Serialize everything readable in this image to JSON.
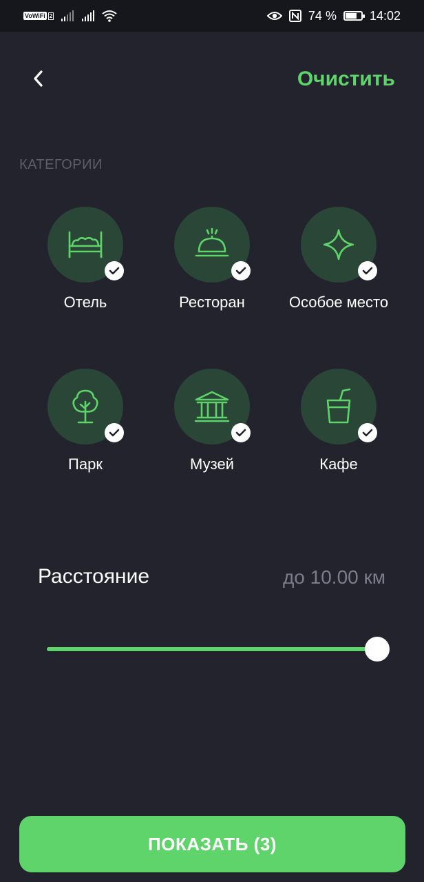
{
  "status_bar": {
    "vowifi": "VoWiFi",
    "vowifi_num": "2",
    "battery_percent": "74 %",
    "battery_level": 0.74,
    "time": "14:02"
  },
  "header": {
    "back_icon": "chevron-left-icon",
    "clear_label": "Очистить"
  },
  "categories_section": {
    "title": "КАТЕГОРИИ",
    "items": [
      {
        "label": "Отель",
        "icon": "bed-icon",
        "selected": true
      },
      {
        "label": "Ресторан",
        "icon": "cloche-icon",
        "selected": true
      },
      {
        "label": "Особое место",
        "icon": "sparkle-icon",
        "selected": true
      },
      {
        "label": "Парк",
        "icon": "tree-icon",
        "selected": true
      },
      {
        "label": "Музей",
        "icon": "museum-icon",
        "selected": true
      },
      {
        "label": "Кафе",
        "icon": "drink-cup-icon",
        "selected": true
      }
    ]
  },
  "distance": {
    "title": "Расстояние",
    "value_label": "до 10.00 км",
    "slider_fraction": 1.0
  },
  "show_button": {
    "label": "ПОКАЗАТЬ (3)"
  },
  "colors": {
    "background": "#22232d",
    "accent": "#5fd46b",
    "icon_circle": "#2a4636",
    "muted_text": "#7b7d8b"
  }
}
